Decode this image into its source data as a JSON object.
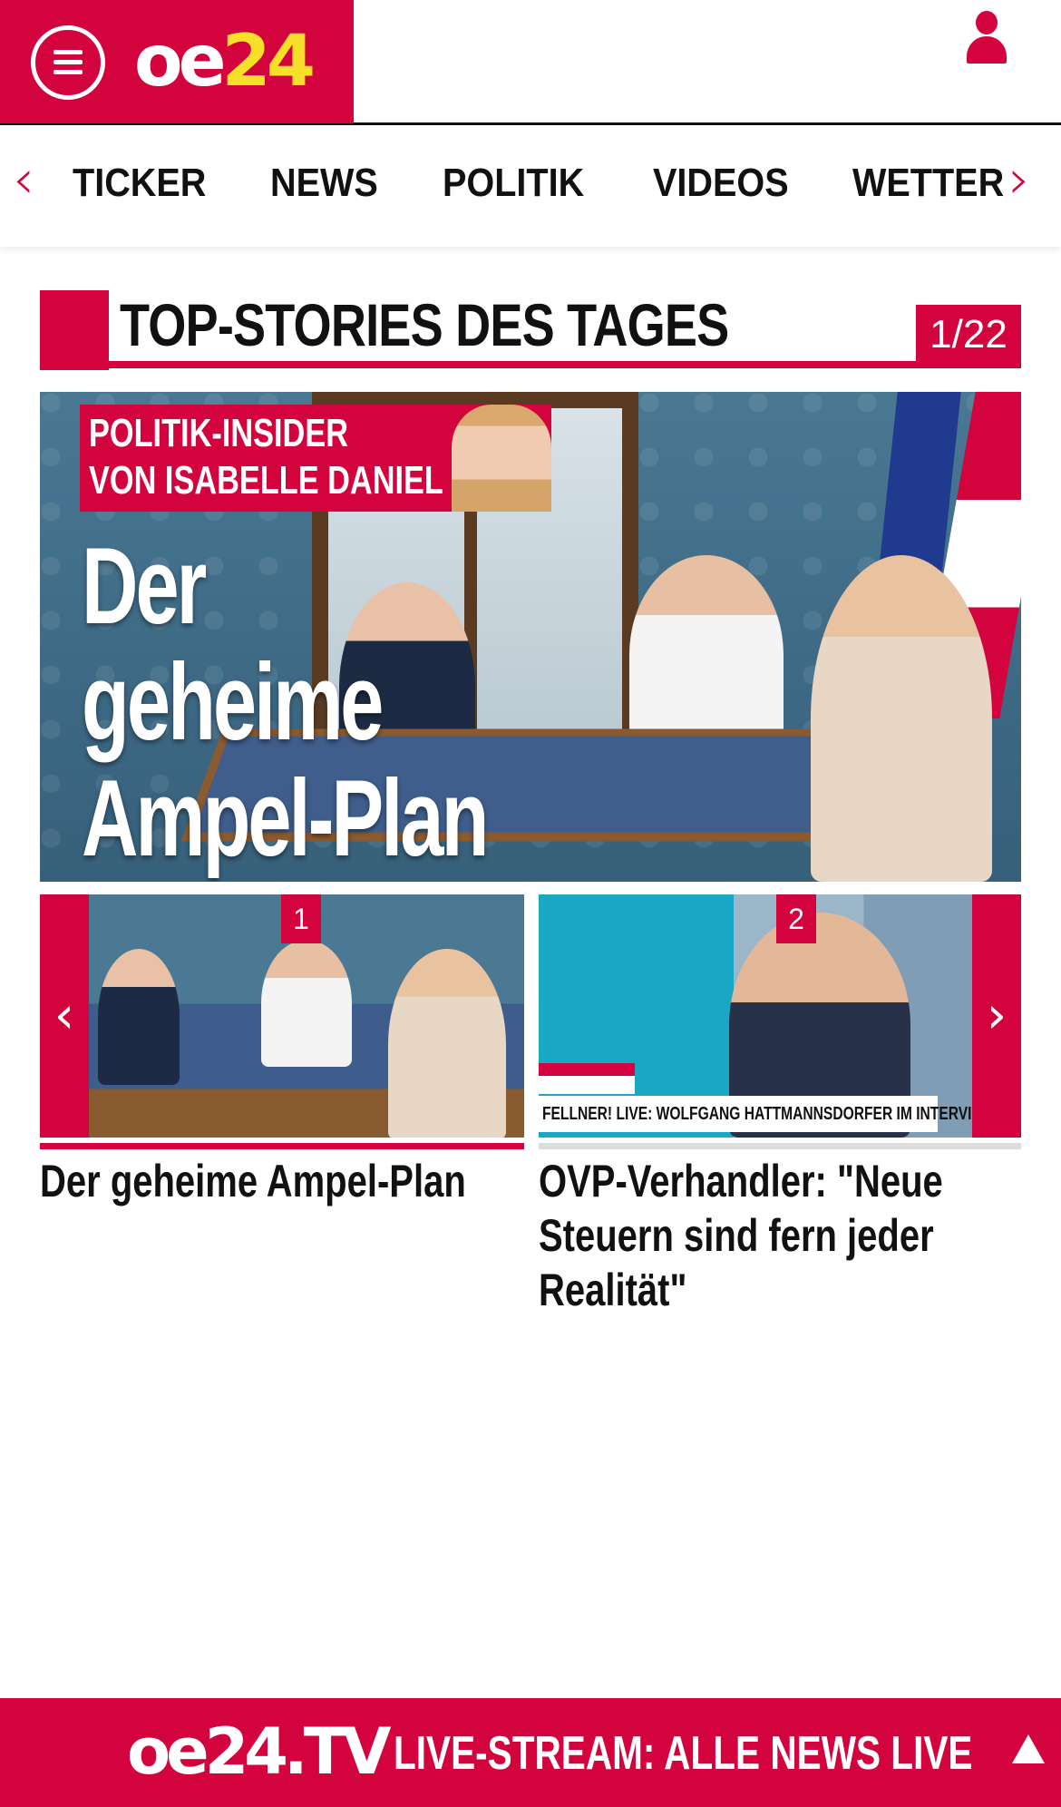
{
  "header": {
    "brand_oe": "oe",
    "brand_num": "24",
    "menu_icon": "hamburger-menu-icon",
    "user_icon": "user-icon",
    "colors": {
      "accent": "#d3043d",
      "brand_yellow": "#f7e02a"
    }
  },
  "nav": {
    "items": [
      {
        "label": "TICKER"
      },
      {
        "label": "NEWS"
      },
      {
        "label": "POLITIK"
      },
      {
        "label": "VIDEOS"
      },
      {
        "label": "WETTER"
      }
    ],
    "prev_arrow": "‹",
    "next_arrow": "›"
  },
  "section": {
    "title": "TOP-STORIES DES TAGES",
    "counter": "1/22"
  },
  "hero": {
    "insider_line1": "POLITIK-INSIDER",
    "insider_line2": "VON ISABELLE DANIEL",
    "headline_line1": "Der",
    "headline_line2": "geheime",
    "headline_line3": "Ampel-Plan"
  },
  "carousel": {
    "prev_arrow": "‹",
    "next_arrow": "›",
    "items": [
      {
        "number": "1",
        "title": "Der geheime Ampel-Plan"
      },
      {
        "number": "2",
        "title": "OVP-Verhandler: \"Neue Steuern sind fern jeder Realität\"",
        "lower_third": "FELLNER! LIVE: WOLFGANG HATTMANNSDORFER IM INTERVIEW"
      }
    ]
  },
  "footer": {
    "brand": "oe24.TV",
    "text": "LIVE-STREAM:  ALLE NEWS LIVE",
    "up_icon": "triangle-up-icon"
  }
}
